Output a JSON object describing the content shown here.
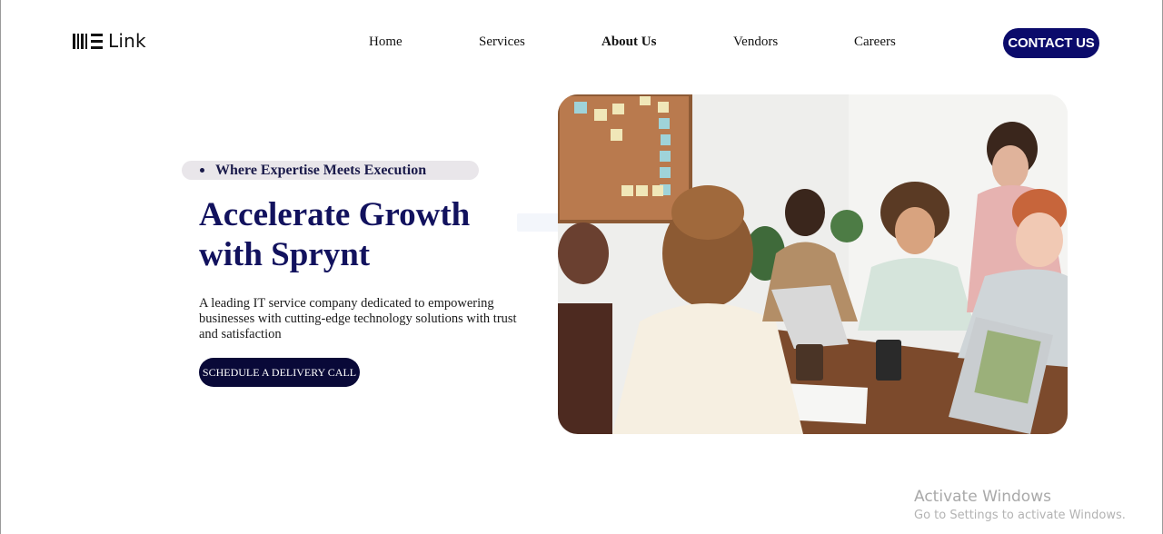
{
  "header": {
    "logo_text": "Link",
    "nav": [
      {
        "label": "Home"
      },
      {
        "label": "Services"
      },
      {
        "label": "About Us"
      },
      {
        "label": "Vendors"
      },
      {
        "label": "Careers"
      }
    ],
    "contact_label": "CONTACT US"
  },
  "hero": {
    "tagline": "Where Expertise Meets Execution",
    "headline": "Accelerate Growth with Sprynt",
    "description": "A leading IT service company dedicated to empowering businesses with cutting-edge technology solutions with trust and satisfaction",
    "cta_label": "SCHEDULE A DELIVERY CALL",
    "image_icon": "team-meeting-photo"
  },
  "watermark": {
    "title": "Activate Windows",
    "subtitle": "Go to Settings to activate Windows."
  },
  "colors": {
    "brand_navy": "#0b0b6b",
    "headline_navy": "#12125e",
    "cta_dark": "#090938",
    "tagline_bg": "#e9e6ea"
  }
}
